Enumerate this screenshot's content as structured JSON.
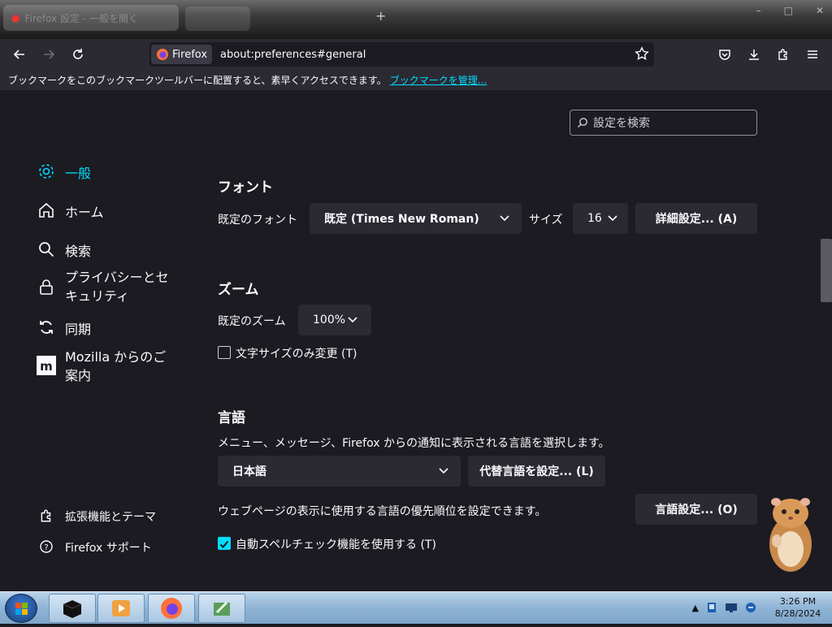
{
  "tabs": {
    "active_title": "Firefox 設定 - 一般を開く"
  },
  "nav": {
    "identity_label": "Firefox",
    "url": "about:preferences#general"
  },
  "bookmarks_bar": {
    "text": "ブックマークをこのブックマークツールバーに配置すると、素早くアクセスできます。",
    "link": "ブックマークを管理..."
  },
  "search": {
    "placeholder": "設定を検索"
  },
  "sidebar": {
    "items": [
      {
        "label": "一般",
        "icon": "gear-icon",
        "active": true
      },
      {
        "label": "ホーム",
        "icon": "home-icon"
      },
      {
        "label": "検索",
        "icon": "search-icon"
      },
      {
        "label": "プライバシーとセキュリティ",
        "icon": "lock-icon"
      },
      {
        "label": "同期",
        "icon": "sync-icon"
      },
      {
        "label": "Mozilla からのご案内",
        "icon": "mozilla-icon"
      }
    ],
    "footer": [
      {
        "label": "拡張機能とテーマ",
        "icon": "puzzle-icon"
      },
      {
        "label": "Firefox サポート",
        "icon": "help-icon"
      }
    ]
  },
  "fonts": {
    "heading": "フォント",
    "default_label": "既定のフォント",
    "default_value": "既定 (Times New Roman)",
    "size_label": "サイズ",
    "size_value": "16",
    "advanced_button": "詳細設定... (A)"
  },
  "zoom": {
    "heading": "ズーム",
    "default_label": "既定のズーム",
    "default_value": "100%",
    "text_only_label": "文字サイズのみ変更 (T)",
    "text_only_checked": false
  },
  "language": {
    "heading": "言語",
    "description": "メニュー、メッセージ、Firefox からの通知に表示される言語を選択します。",
    "value": "日本語",
    "alternatives_button": "代替言語を設定... (L)",
    "web_description": "ウェブページの表示に使用する言語の優先順位を設定できます。",
    "settings_button": "言語設定... (O)",
    "spellcheck_label": "自動スペルチェック機能を使用する (T)",
    "spellcheck_checked": true
  },
  "taskbar": {
    "time": "3:26 PM",
    "date": "8/28/2024"
  },
  "colors": {
    "accent": "#00ddff",
    "background": "#1c1b22",
    "panel": "#2b2a33"
  }
}
